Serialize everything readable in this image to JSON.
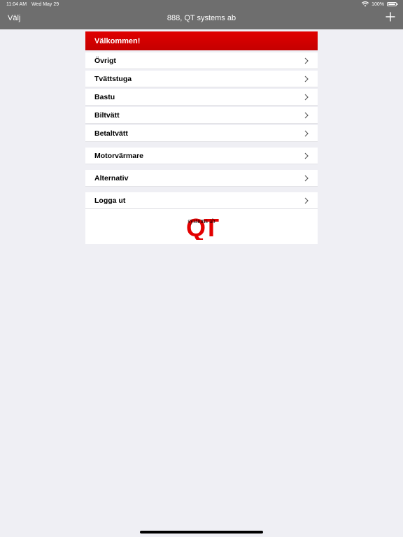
{
  "status_bar": {
    "time": "11:04 AM",
    "date": "Wed May 29",
    "battery": "100%"
  },
  "nav": {
    "left_button": "Välj",
    "title": "888, QT systems ab",
    "right_icon": "plus-icon"
  },
  "menu": {
    "header": "Välkommen!",
    "group1": [
      {
        "label": "Övrigt"
      },
      {
        "label": "Tvättstuga"
      },
      {
        "label": "Bastu"
      },
      {
        "label": "Biltvätt"
      },
      {
        "label": "Betaltvätt"
      }
    ],
    "group2": [
      {
        "label": "Motorvärmare"
      }
    ],
    "group3": [
      {
        "label": "Alternativ"
      }
    ],
    "group4": [
      {
        "label": "Logga ut"
      }
    ]
  },
  "logo": {
    "text": "QT",
    "subtitle": "systems ab",
    "color": "#e30000"
  },
  "colors": {
    "accent": "#d40000",
    "bar": "#6e6e6e",
    "background": "#efeff4"
  }
}
